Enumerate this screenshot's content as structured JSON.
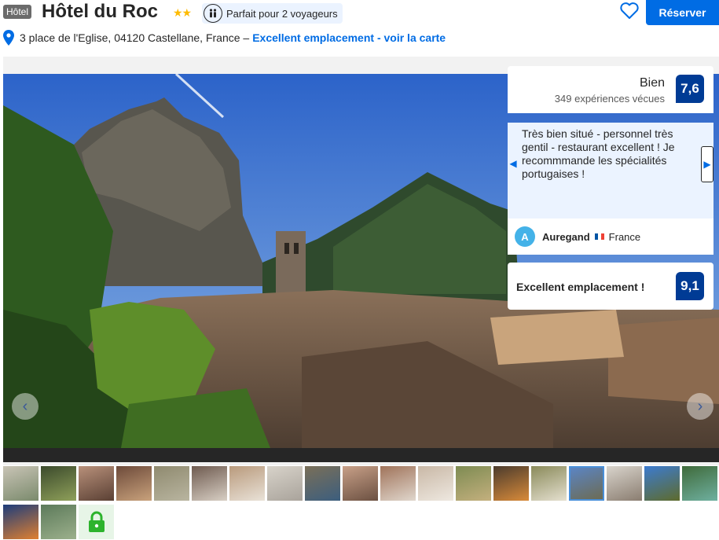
{
  "header": {
    "type_badge": "Hôtel",
    "title": "Hôtel du Roc",
    "stars": "★★",
    "capacity_label": "Parfait pour 2 voyageurs",
    "reserve_label": "Réserver"
  },
  "address": {
    "text": "3 place de l'Eglise, 04120 Castellane, France –",
    "link_text": "Excellent emplacement - voir la carte"
  },
  "rating": {
    "word": "Bien",
    "count_text": "349 expériences vécues",
    "score": "7,6"
  },
  "review": {
    "text": "Très bien situé - personnel très gentil - restaurant excellent ! Je recommmande les spécialités portugaises !",
    "reviewer_initial": "A",
    "reviewer_name": "Auregand",
    "reviewer_country": "France"
  },
  "location": {
    "label": "Excellent emplacement !",
    "score": "9,1"
  },
  "gallery": {
    "prev_icon": "‹",
    "next_icon": "›",
    "selected_thumbnail_index": 15,
    "thumbnail_count": 21
  },
  "colors": {
    "brand_blue": "#006ce4",
    "score_navy": "#003b95",
    "star_gold": "#febb02",
    "review_bg": "#ebf3ff",
    "lock_green": "#2db32d"
  }
}
